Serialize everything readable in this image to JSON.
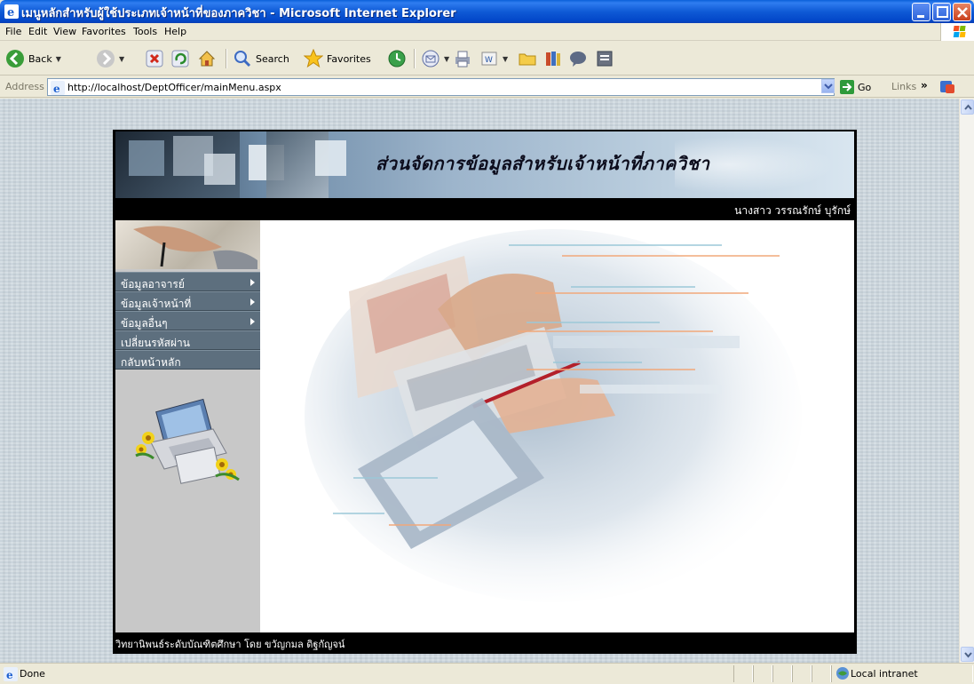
{
  "window": {
    "title": "เมนูหลักสำหรับผู้ใช้ประเภทเจ้าหน้าที่ของภาควิชา - Microsoft Internet Explorer"
  },
  "menubar": {
    "items": [
      "File",
      "Edit",
      "View",
      "Favorites",
      "Tools",
      "Help"
    ]
  },
  "toolbar": {
    "back_label": "Back",
    "search_label": "Search",
    "favorites_label": "Favorites"
  },
  "addressbar": {
    "label": "Address",
    "url": "http://localhost/DeptOfficer/mainMenu.aspx",
    "go_label": "Go",
    "links_label": "Links",
    "links_chevron": "»"
  },
  "page": {
    "banner_title": "ส่วนจัดการข้อมูลสำหรับเจ้าหน้าที่ภาควิชา",
    "username": "นางสาว วรรณรักษ์ บุรักษ์",
    "menu": [
      {
        "label": "ข้อมูลอาจารย์",
        "has_submenu": true
      },
      {
        "label": "ข้อมูลเจ้าหน้าที่",
        "has_submenu": true
      },
      {
        "label": "ข้อมูลอื่นๆ",
        "has_submenu": true
      },
      {
        "label": "เปลี่ยนรหัสผ่าน",
        "has_submenu": false
      },
      {
        "label": "กลับหน้าหลัก",
        "has_submenu": false
      }
    ],
    "footer": "วิทยานิพนธ์ระดับบัณฑิตศึกษา โดย ขวัญกมล ดิฐกัญจน์"
  },
  "statusbar": {
    "status": "Done",
    "zone": "Local intranet"
  },
  "colors": {
    "title_bar": "#0a5fd8",
    "menu_item_bg": "#5d6f7e",
    "page_frame": "#000000",
    "sidebar_bg": "#c8c8c8"
  }
}
